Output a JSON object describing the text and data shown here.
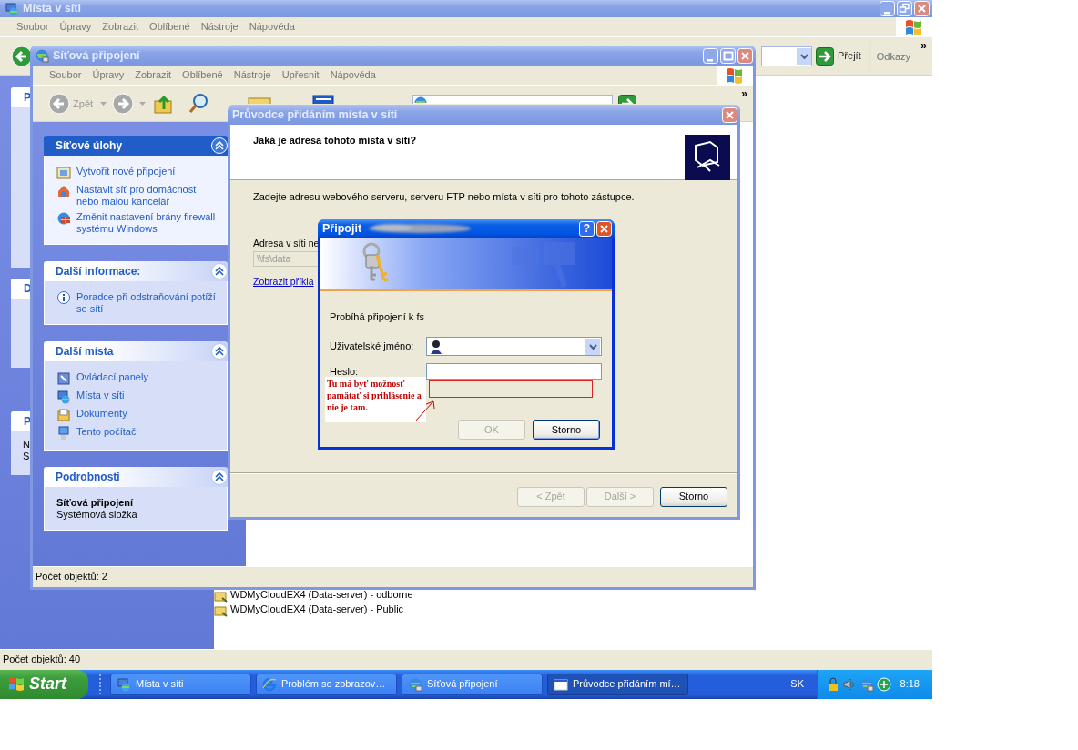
{
  "main_window": {
    "title": "Místa v síti",
    "menu": [
      "Soubor",
      "Úpravy",
      "Zobrazit",
      "Oblíbené",
      "Nástroje",
      "Nápověda"
    ],
    "go_button": "Přejít",
    "links_label": "Odkazy",
    "toolbar_chevron": "»",
    "sidebar_fragments": [
      {
        "heading": "P"
      },
      {
        "heading": "D"
      },
      {
        "heading": "P",
        "lines": [
          "N",
          "S"
        ]
      }
    ],
    "files": [
      {
        "name": "WDMyCloudEX4 (Data-server) - odborne"
      },
      {
        "name": "WDMyCloudEX4 (Data-server) - Public"
      }
    ],
    "status_bar": "Počet objektů: 40"
  },
  "connections_window": {
    "title": "Síťová připojení",
    "menu": [
      "Soubor",
      "Úpravy",
      "Zobrazit",
      "Oblíbené",
      "Nástroje",
      "Upřesnit",
      "Nápověda"
    ],
    "back_button": "Zpět",
    "toolbar_chevron": "»",
    "task_panels": [
      {
        "title": "Síťové úlohy",
        "kind": "special",
        "expanded": true,
        "items": [
          {
            "label": "Vytvořit nové připojení"
          },
          {
            "label": "Nastavit síť pro domácnost nebo malou kancelář"
          },
          {
            "label": "Změnit nastavení brány firewall systému Windows"
          }
        ]
      },
      {
        "title": "Další informace:",
        "kind": "normal",
        "expanded": true,
        "items": [
          {
            "label": "Poradce při odstraňování potíží se sítí"
          }
        ]
      },
      {
        "title": "Další místa",
        "kind": "normal",
        "expanded": true,
        "items": [
          {
            "label": "Ovládací panely"
          },
          {
            "label": "Místa v síti"
          },
          {
            "label": "Dokumenty"
          },
          {
            "label": "Tento počítač"
          }
        ]
      },
      {
        "title": "Podrobnosti",
        "kind": "details",
        "expanded": true,
        "name": "Síťová připojení",
        "description": "Systémová složka"
      }
    ],
    "status_bar": "Počet objektů: 2"
  },
  "wizard": {
    "title": "Průvodce přidáním místa v síti",
    "heading": "Jaká je adresa tohoto místa v síti?",
    "instruction": "Zadejte adresu webového serveru, serveru FTP nebo místa v síti pro tohoto zástupce.",
    "address_label": "Adresa v síti ne",
    "address_value": "\\\\fs\\data",
    "example_link": "Zobrazit příkla",
    "buttons": [
      {
        "label": "< Zpět",
        "disabled": true
      },
      {
        "label": "Další >",
        "disabled": true
      },
      {
        "label": "Storno",
        "disabled": false
      }
    ]
  },
  "dialog": {
    "title": "Připojit",
    "help_button": "?",
    "message": "Probíhá připojení k fs",
    "username_label": "Uživatelské jméno:",
    "password_label": "Heslo:",
    "annotation": "Tu má byť možnosť pamätať si prihlásenie a nie je tam.",
    "buttons": [
      {
        "label": "OK",
        "disabled": true
      },
      {
        "label": "Storno",
        "disabled": false
      }
    ]
  },
  "taskbar": {
    "start": "Start",
    "tasks": [
      {
        "label": "Místa v síti",
        "selected": false
      },
      {
        "label": "Problém so zobrazov…",
        "selected": false
      },
      {
        "label": "Síťová připojení",
        "selected": false
      },
      {
        "label": "Průvodce přidáním mí…",
        "selected": true
      }
    ],
    "language": "SK",
    "clock": "8:18"
  }
}
